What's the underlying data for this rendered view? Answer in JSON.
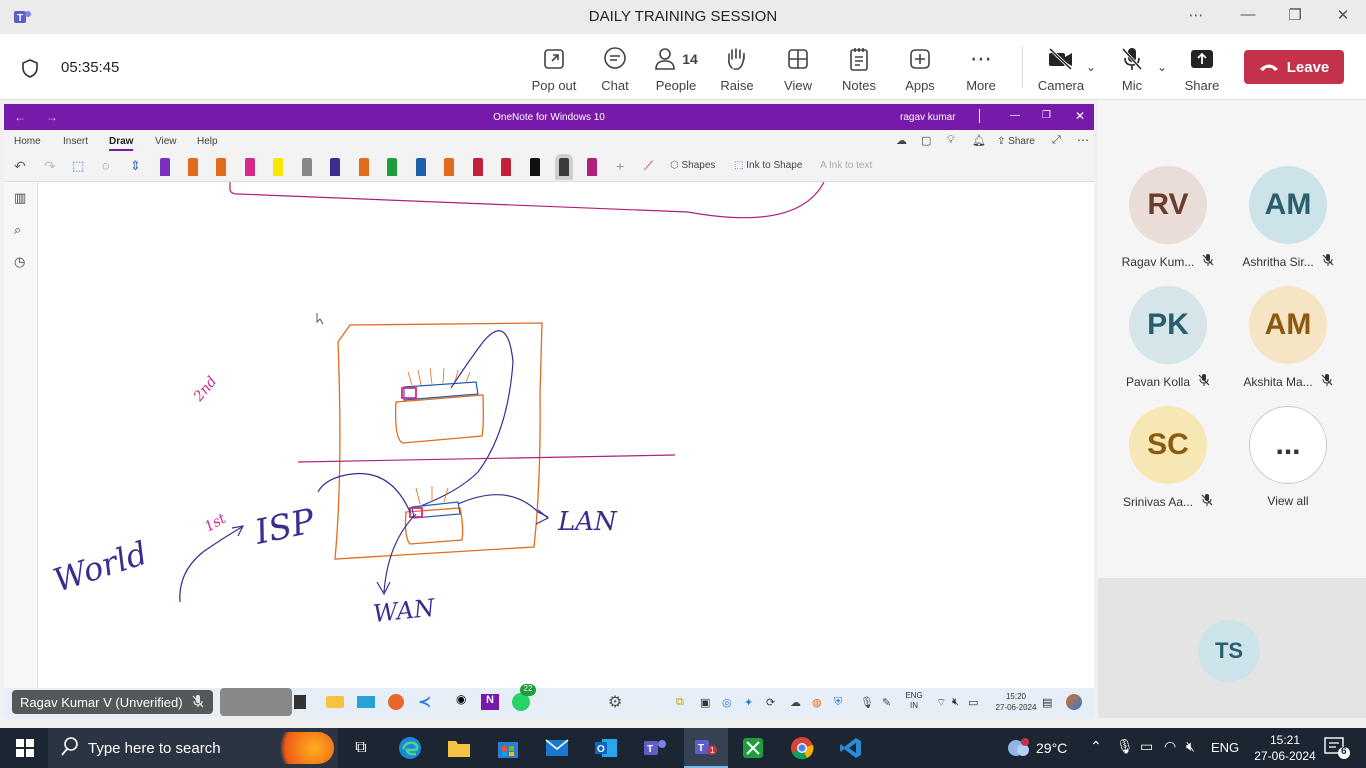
{
  "window": {
    "title": "DAILY TRAINING SESSION"
  },
  "meeting": {
    "timer": "05:35:45",
    "buttons": {
      "popout": "Pop out",
      "chat": "Chat",
      "people": "People",
      "people_count": "14",
      "raise": "Raise",
      "view": "View",
      "notes": "Notes",
      "apps": "Apps",
      "more": "More",
      "camera": "Camera",
      "mic": "Mic",
      "share": "Share",
      "leave": "Leave"
    }
  },
  "onenote": {
    "title": "OneNote for Windows 10",
    "user": "ragav kumar",
    "tabs": [
      "Home",
      "Insert",
      "Draw",
      "View",
      "Help"
    ],
    "active_tab": "Draw",
    "tools": {
      "shapes": "Shapes",
      "ink_to_shape": "Ink to Shape",
      "ink_to_text": "Ink to text",
      "share": "Share"
    },
    "pen_colors": [
      "#7b2fbe",
      "#e36b1d",
      "#e36b1d",
      "#d6278a",
      "#ffe600",
      "#888888",
      "#3a2d8f",
      "#e36b1d",
      "#1f9e3c",
      "#1f5ea8",
      "#e36b1d",
      "#c21f3a",
      "#c21f3a",
      "#111111",
      "#3a3a3a",
      "#b0207a"
    ],
    "handwriting": {
      "world": "World",
      "first": "1st",
      "second": "2nd",
      "isp": "ISP",
      "lan": "LAN",
      "wan": "WAN"
    }
  },
  "inner_taskbar": {
    "lang_top": "ENG",
    "lang_bottom": "IN",
    "time": "15:20",
    "date": "27-06-2024",
    "badge": "22"
  },
  "presenter_caption": "Ragav Kumar V (Unverified)",
  "participants": [
    {
      "initials": "RV",
      "name": "Ragav Kum...",
      "bg": "#eaddd7",
      "fg": "#6b3d2e",
      "muted": true
    },
    {
      "initials": "AM",
      "name": "Ashritha Sir...",
      "bg": "#cde3ea",
      "fg": "#2a5d6e",
      "muted": true
    },
    {
      "initials": "PK",
      "name": "Pavan Kolla",
      "bg": "#d5e5e8",
      "fg": "#2a5d6e",
      "muted": true
    },
    {
      "initials": "AM",
      "name": "Akshita Ma...",
      "bg": "#f5e5c5",
      "fg": "#8a5a10",
      "muted": true
    },
    {
      "initials": "SC",
      "name": "Srinivas Aa...",
      "bg": "#f7e7b4",
      "fg": "#8a5a10",
      "muted": true
    },
    {
      "initials": "...",
      "name": "View all",
      "bg": "#ffffff",
      "fg": "#333333",
      "muted": false
    }
  ],
  "spotlight": {
    "initials": "TS"
  },
  "windows_taskbar": {
    "search_placeholder": "Type here to search",
    "weather": "29°C",
    "lang": "ENG",
    "time": "15:21",
    "date": "27-06-2024",
    "notifications": "6"
  }
}
